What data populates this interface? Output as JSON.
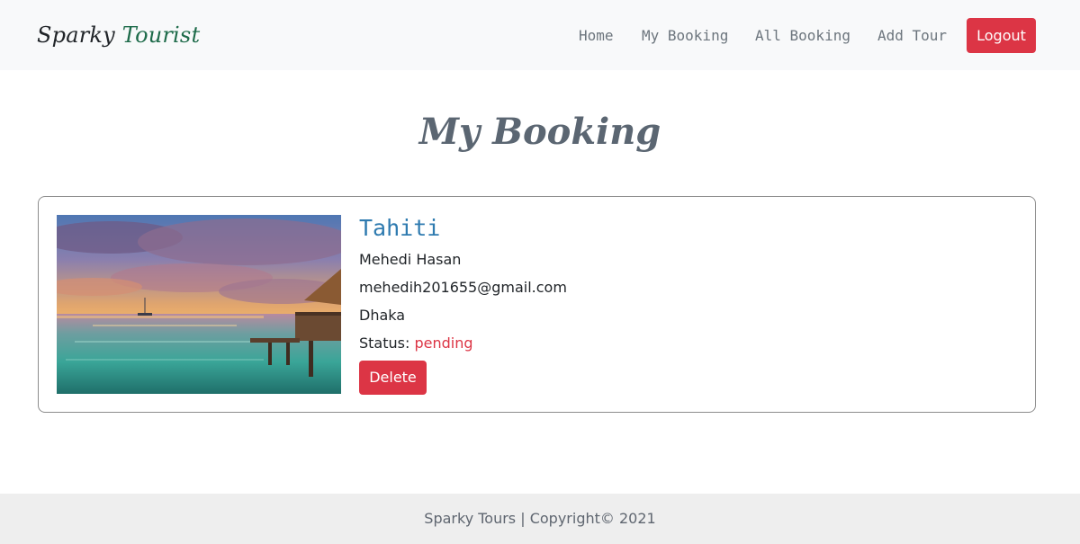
{
  "navbar": {
    "brand_part1": "Sparky",
    "brand_part2": "Tourist",
    "links": [
      {
        "label": "Home"
      },
      {
        "label": "My Booking"
      },
      {
        "label": "All Booking"
      },
      {
        "label": "Add Tour"
      }
    ],
    "logout_label": "Logout"
  },
  "page": {
    "title": "My Booking"
  },
  "booking": {
    "tour_name": "Tahiti",
    "name": "Mehedi Hasan",
    "email": "mehedih201655@gmail.com",
    "address": "Dhaka",
    "status_label": "Status: ",
    "status_value": "pending",
    "delete_label": "Delete",
    "image_icon": "overwater-bungalow-sunset-photo"
  },
  "footer": {
    "text": "Sparky Tours | Copyright© 2021"
  },
  "colors": {
    "danger": "#dc3545",
    "navbar_bg": "#f8f9fa",
    "brand_accent": "#1e6b4a",
    "tour_name": "#2f7bb0",
    "footer_bg": "#eeeeee"
  }
}
